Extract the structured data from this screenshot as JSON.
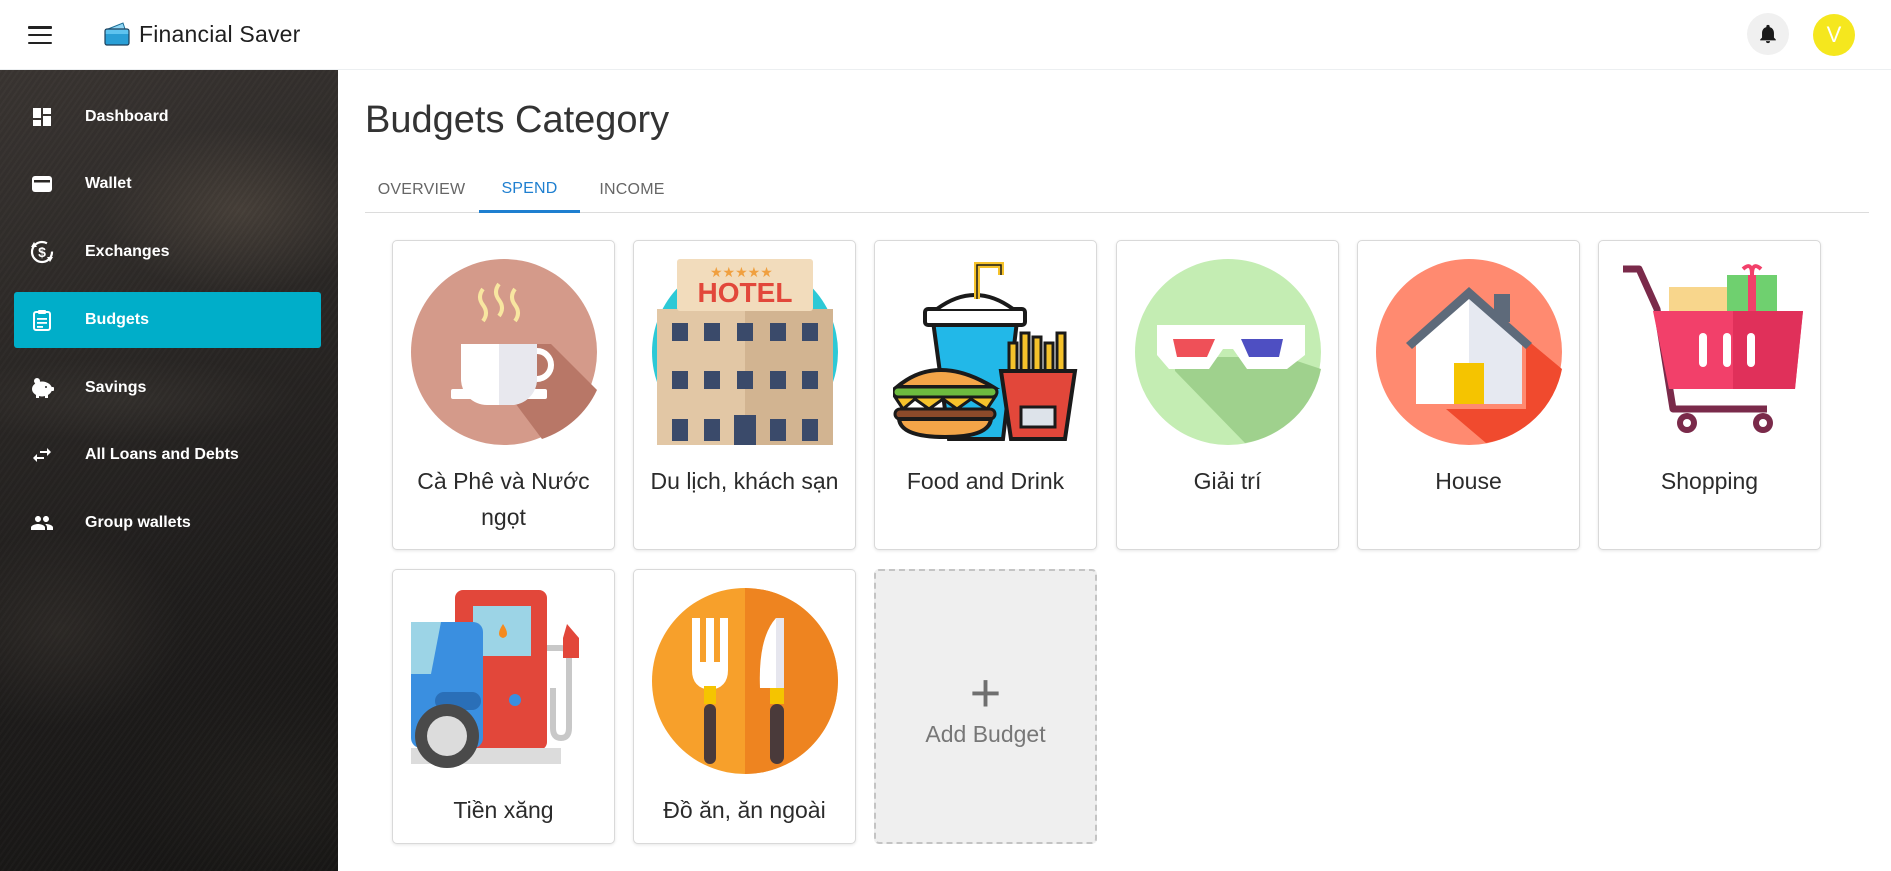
{
  "app": {
    "brand_name": "Financial Saver",
    "user_initial": "V"
  },
  "sidebar": {
    "items": [
      {
        "label": "Dashboard",
        "icon": "dashboard-icon",
        "active": false
      },
      {
        "label": "Wallet",
        "icon": "wallet-icon",
        "active": false
      },
      {
        "label": "Exchanges",
        "icon": "exchange-icon",
        "active": false
      },
      {
        "label": "Budgets",
        "icon": "clipboard-icon",
        "active": true
      },
      {
        "label": "Savings",
        "icon": "piggy-bank-icon",
        "active": false
      },
      {
        "label": "All Loans and Debts",
        "icon": "transfer-arrows-icon",
        "active": false
      },
      {
        "label": "Group wallets",
        "icon": "people-icon",
        "active": false
      }
    ]
  },
  "main": {
    "title": "Budgets Category",
    "tabs": [
      {
        "label": "OVERVIEW",
        "active": false
      },
      {
        "label": "SPEND",
        "active": true
      },
      {
        "label": "INCOME",
        "active": false
      }
    ],
    "categories": [
      {
        "label": "Cà Phê và Nước ngọt",
        "icon": "coffee-cup-icon"
      },
      {
        "label": "Du lịch, khách sạn",
        "icon": "hotel-icon"
      },
      {
        "label": "Food and Drink",
        "icon": "fast-food-icon"
      },
      {
        "label": "Giải trí",
        "icon": "3d-glasses-icon"
      },
      {
        "label": "House",
        "icon": "house-icon"
      },
      {
        "label": "Shopping",
        "icon": "shopping-cart-icon"
      },
      {
        "label": "Tiền xăng",
        "icon": "gas-station-icon"
      },
      {
        "label": "Đồ ăn, ăn ngoài",
        "icon": "fork-knife-icon"
      }
    ],
    "add_budget": {
      "plus": "+",
      "label": "Add Budget"
    },
    "hotel_sign": "HOTEL"
  },
  "colors": {
    "accent": "#00aec9",
    "tab_active": "#1e7fd0",
    "avatar": "#f5e71e"
  }
}
